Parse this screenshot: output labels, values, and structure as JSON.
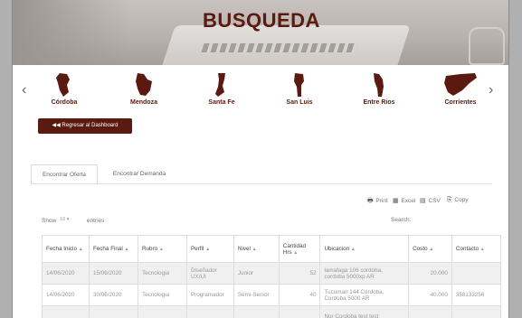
{
  "header": {
    "title": "BUSQUEDA"
  },
  "carousel": {
    "provinces": [
      {
        "name": "Córdoba"
      },
      {
        "name": "Mendoza"
      },
      {
        "name": "Santa Fe"
      },
      {
        "name": "San Luis"
      },
      {
        "name": "Entre Rios"
      },
      {
        "name": "Corrientes"
      }
    ]
  },
  "actions": {
    "back_label": "◀◀ Regresar al Dashboard"
  },
  "tabs": [
    {
      "label": "Encontrar Oferta"
    },
    {
      "label": "Encontrar Demanda"
    }
  ],
  "exports": {
    "print": "Print",
    "excel": "Excel",
    "csv": "CSV",
    "copy": "Copy"
  },
  "table_controls": {
    "show_label": "Show",
    "show_value": "10",
    "entries_label": "entries",
    "search_label": "Search:"
  },
  "table": {
    "headers": [
      "Fecha Inicio",
      "Fecha Final",
      "Rubro",
      "Perfil",
      "Nivel",
      "Cantidad Hrs",
      "Ubicacion",
      "Costo",
      "Contacto"
    ],
    "rows": [
      [
        "14/06/2020",
        "15/06/2020",
        "Tecnologia",
        "Diseñador UX/UI",
        "Junior",
        "52",
        "lamafaga 106 cordoba, cordoba 5000xp AR",
        "20.000",
        ""
      ],
      [
        "14/06/2020",
        "30/06/2020",
        "Tecnologia",
        "Programador",
        "Semi-Senior",
        "40",
        "Tucuman 144 Córdoba, Cordoba 5000 AR",
        "40.000",
        "358133256"
      ],
      [
        "",
        "",
        "",
        "",
        "",
        "",
        "Nor Cordoba test test",
        "",
        ""
      ]
    ]
  },
  "colors": {
    "brand": "#5a1a0f",
    "row_alt": "#f0f0f0"
  }
}
